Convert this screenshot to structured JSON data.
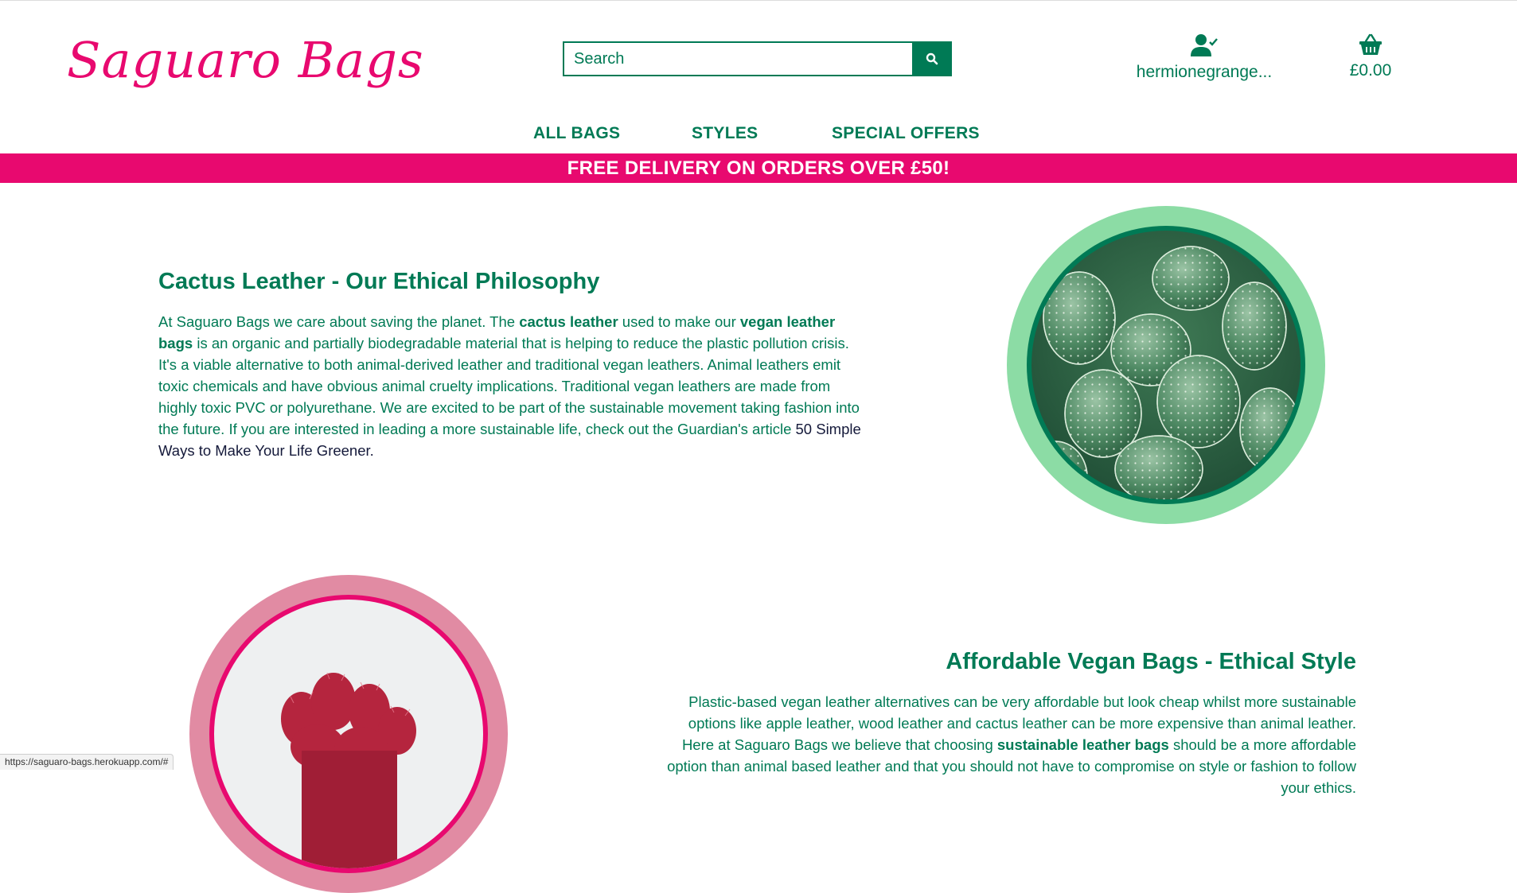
{
  "brand": {
    "name": "Saguaro Bags",
    "logo_color": "#e8096f",
    "accent": "#007a55"
  },
  "search": {
    "placeholder": "Search"
  },
  "account": {
    "username": "hermionegrange..."
  },
  "basket": {
    "total": "£0.00"
  },
  "nav": {
    "items": [
      {
        "label": "ALL BAGS"
      },
      {
        "label": "STYLES"
      },
      {
        "label": "SPECIAL OFFERS"
      }
    ]
  },
  "banner": {
    "text": "FREE DELIVERY ON ORDERS OVER £50!"
  },
  "section1": {
    "title": "Cactus Leather - Our Ethical Philosophy",
    "p_a": "At Saguaro Bags we care about saving the planet. The ",
    "bold1": "cactus leather",
    "p_b": " used to make our ",
    "bold2": "vegan leather bags",
    "p_c": " is an organic and partially biodegradable material that is helping to reduce the plastic pollution crisis. It's a viable alternative to both animal-derived leather and traditional vegan leathers. Animal leathers emit toxic chemicals and have obvious animal cruelty implications. Traditional vegan leathers are made from highly toxic PVC or polyurethane. We are excited to be part of the sustainable movement taking fashion into the future. If you are interested in leading a more sustainable life, check out the Guardian's article ",
    "link": "50 Simple Ways to Make Your Life Greener.",
    "circle_colors": {
      "outer": "#8cdca5",
      "ring": "#007a55"
    }
  },
  "section2": {
    "title": "Affordable Vegan Bags - Ethical Style",
    "p_a": "Plastic-based vegan leather alternatives can be very affordable but look cheap whilst more sustainable options like apple leather, wood leather and cactus leather can be more expensive than animal leather. Here at Saguaro Bags we believe that choosing ",
    "bold1": "sustainable leather bags",
    "p_b": " should be a more affordable option than animal based leather and that you should not have to compromise on style or fashion to follow your ethics.",
    "circle_colors": {
      "outer": "#e18ba3",
      "ring": "#e8096f"
    }
  },
  "status_bar": {
    "url": "https://saguaro-bags.herokuapp.com/#"
  }
}
